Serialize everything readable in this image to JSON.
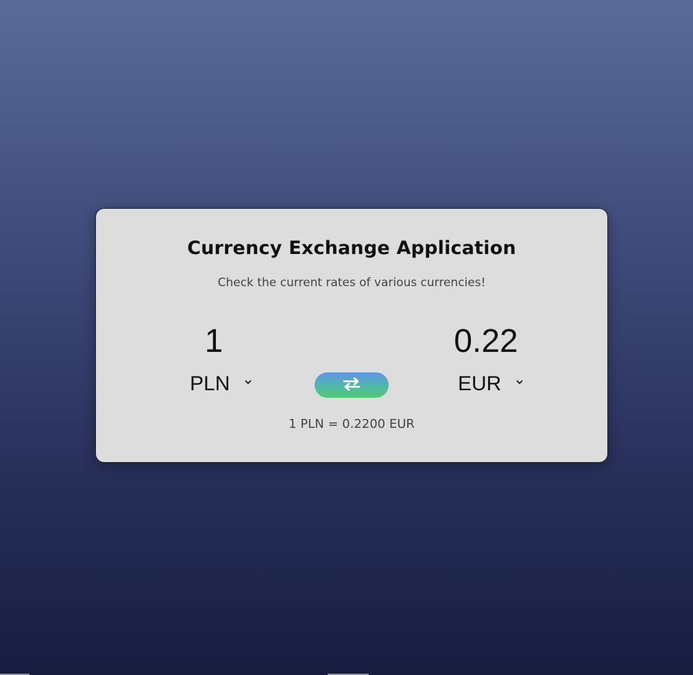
{
  "app": {
    "title": "Currency Exchange Application",
    "subtitle": "Check the current rates of various currencies!"
  },
  "converter": {
    "from": {
      "amount": "1",
      "currency": "PLN"
    },
    "to": {
      "amount": "0.22",
      "currency": "EUR"
    },
    "swap_icon": "swap-arrows-icon",
    "rate_text": "1 PLN = 0.2200 EUR"
  },
  "colors": {
    "swap_gradient_top": "#5f93e8",
    "swap_gradient_bottom": "#52c875",
    "card_background": "#dddddd"
  }
}
